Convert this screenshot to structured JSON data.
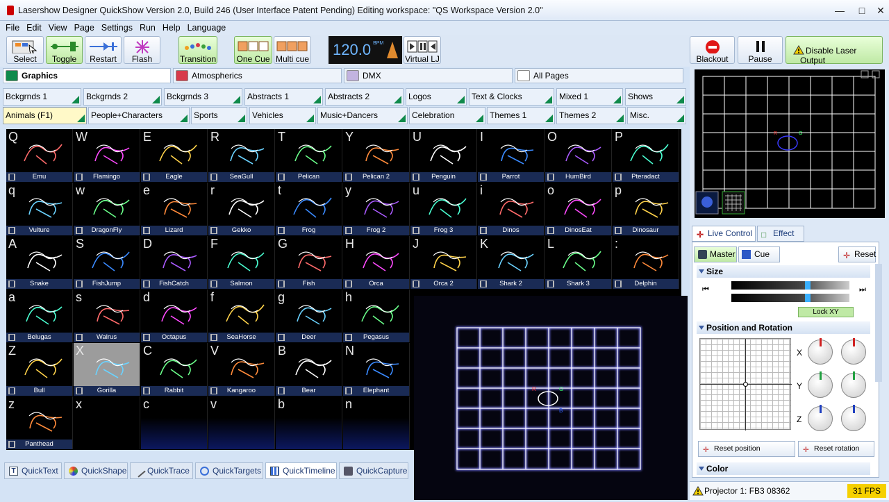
{
  "window": {
    "title": "Lasershow Designer QuickShow   Version 2.0, Build 246   (User Interface Patent Pending)   Editing workspace: \"QS Workspace Version 2.0\""
  },
  "menu": [
    "File",
    "Edit",
    "View",
    "Page",
    "Settings",
    "Run",
    "Help",
    "Language"
  ],
  "toolbar": {
    "select": "Select",
    "toggle": "Toggle",
    "restart": "Restart",
    "flash": "Flash",
    "transition": "Transition",
    "one_cue": "One Cue",
    "multi_cue": "Multi cue",
    "bpm": "120.0",
    "bpm_unit": "BPM",
    "virtual_lj": "Virtual LJ",
    "blackout": "Blackout",
    "pause": "Pause",
    "disable_output": "Disable Laser Output"
  },
  "categories": [
    {
      "label": "Graphics",
      "color": "#0f8a4b",
      "active": true
    },
    {
      "label": "Atmospherics",
      "color": "#d83a4a",
      "active": false
    },
    {
      "label": "DMX",
      "color": "#c2b3e0",
      "active": false
    },
    {
      "label": "All Pages",
      "color": "#ffffff",
      "active": false
    }
  ],
  "tabs_row1": [
    "Bckgrnds 1",
    "Bckgrnds 2",
    "Bckgrnds 3",
    "Abstracts 1",
    "Abstracts 2",
    "Logos",
    "Text & Clocks",
    "Mixed 1",
    "Shows"
  ],
  "tabs_row2": [
    "Animals (F1)",
    "People+Characters",
    "Sports",
    "Vehicles",
    "Music+Dancers",
    "Celebration",
    "Themes 1",
    "Themes 2",
    "Misc."
  ],
  "cues": [
    [
      [
        "Q",
        "Emu"
      ],
      [
        "W",
        "Flamingo"
      ],
      [
        "E",
        "Eagle"
      ],
      [
        "R",
        "SeaGull"
      ],
      [
        "T",
        "Pelican"
      ],
      [
        "Y",
        "Pelican 2"
      ],
      [
        "U",
        "Penguin"
      ],
      [
        "I",
        "Parrot"
      ],
      [
        "O",
        "HumBird"
      ],
      [
        "P",
        "Pteradact"
      ]
    ],
    [
      [
        "q",
        "Vulture"
      ],
      [
        "w",
        "DragonFly"
      ],
      [
        "e",
        "Lizard"
      ],
      [
        "r",
        "Gekko"
      ],
      [
        "t",
        "Frog"
      ],
      [
        "y",
        "Frog 2"
      ],
      [
        "u",
        "Frog 3"
      ],
      [
        "i",
        "Dinos"
      ],
      [
        "o",
        "DinosEat"
      ],
      [
        "p",
        "Dinosaur"
      ]
    ],
    [
      [
        "A",
        "Snake"
      ],
      [
        "S",
        "FishJump"
      ],
      [
        "D",
        "FishCatch"
      ],
      [
        "F",
        "Salmon"
      ],
      [
        "G",
        "Fish"
      ],
      [
        "H",
        "Orca"
      ],
      [
        "J",
        "Orca 2"
      ],
      [
        "K",
        "Shark 2"
      ],
      [
        "L",
        "Shark 3"
      ],
      [
        ":",
        "Delphin"
      ]
    ],
    [
      [
        "a",
        "Belugas"
      ],
      [
        "s",
        "Walrus"
      ],
      [
        "d",
        "Octapus"
      ],
      [
        "f",
        "SeaHorse"
      ],
      [
        "g",
        "Deer"
      ],
      [
        "h",
        "Pegasus"
      ]
    ],
    [
      [
        "Z",
        "Bull"
      ],
      [
        "X",
        "Gorilla"
      ],
      [
        "C",
        "Rabbit"
      ],
      [
        "V",
        "Kangaroo"
      ],
      [
        "B",
        "Bear"
      ],
      [
        "N",
        "Elephant"
      ]
    ],
    [
      [
        "z",
        "Panthead"
      ],
      [
        "x",
        ""
      ],
      [
        "c",
        ""
      ],
      [
        "v",
        ""
      ],
      [
        "b",
        ""
      ],
      [
        "n",
        ""
      ]
    ]
  ],
  "lower_tabs": [
    "QuickText",
    "QuickShape",
    "QuickTrace",
    "QuickTargets",
    "QuickTimeline",
    "QuickCapture"
  ],
  "live_control": {
    "tab_live": "Live Control",
    "tab_effect": "Effect",
    "master": "Master",
    "cue": "Cue",
    "reset": "Reset",
    "size": "Size",
    "lock_xy": "Lock XY",
    "position_rotation": "Position and Rotation",
    "x": "X",
    "y": "Y",
    "z": "Z",
    "reset_position": "Reset position",
    "reset_rotation": "Reset rotation",
    "color": "Color"
  },
  "status": {
    "projector": "Projector 1: FB3 08362",
    "fps": "31 FPS"
  },
  "colors": {
    "accent_green": "#0f8a4b",
    "laser_blue": "#5a5cff",
    "laser_white": "#ffffff"
  }
}
